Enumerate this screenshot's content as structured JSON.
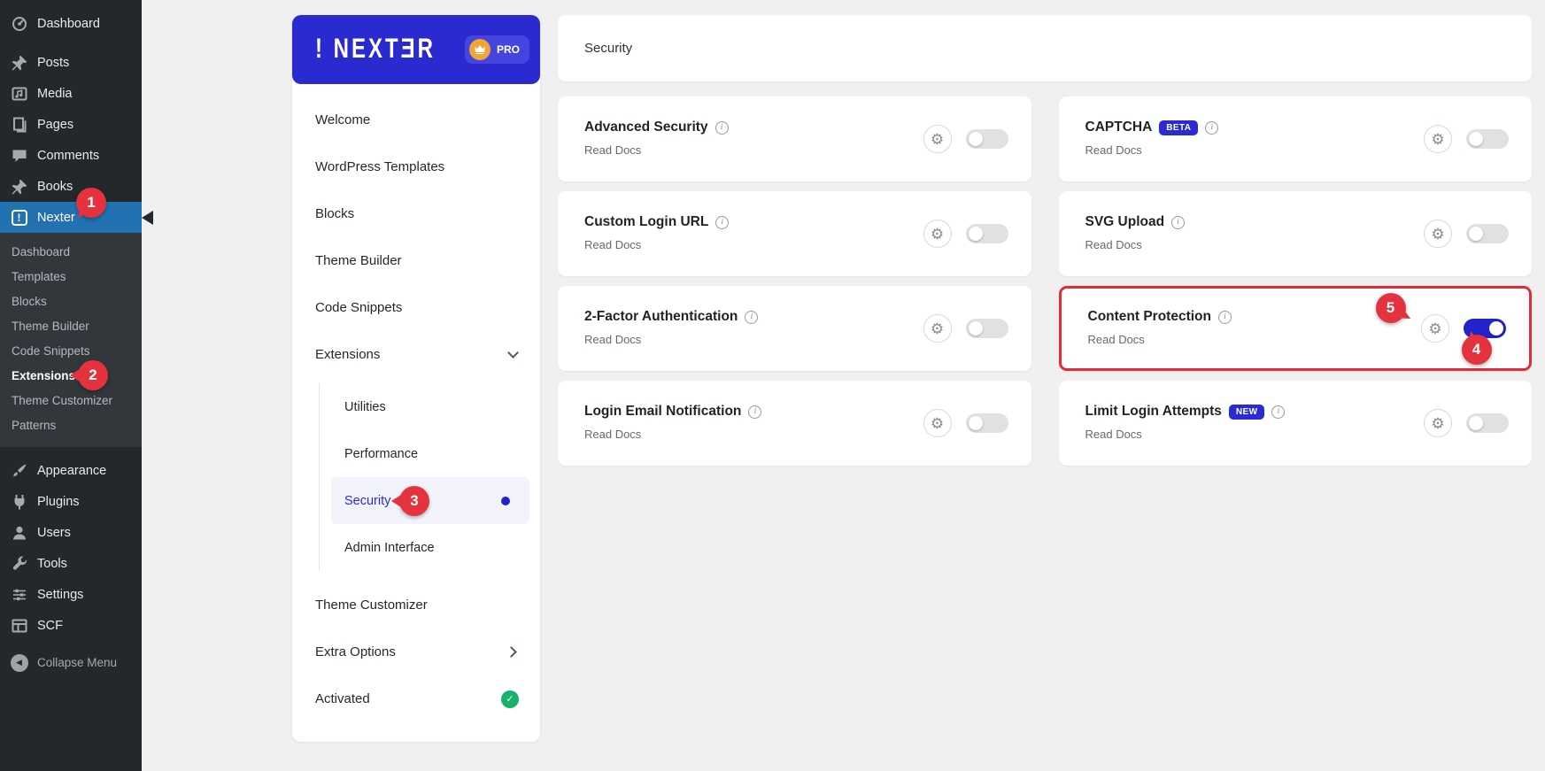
{
  "colors": {
    "brand_blue": "#2a2ad0",
    "toggle_on_blue": "#2323cd",
    "wp_active_blue": "#2271b1",
    "callout_red": "#e4323f",
    "highlight_border_red": "#e12d39",
    "success_green": "#17b26a",
    "badge_blue": "#2b2bd3"
  },
  "icons": {
    "gear": "⚙",
    "check": "✓",
    "info": "i",
    "exclamation": "!",
    "collapse_arrow": "◀"
  },
  "admin_sidebar": {
    "items": [
      {
        "label": "Dashboard",
        "icon": "dashboard-icon"
      },
      {
        "label": "Posts",
        "icon": "pushpin-icon"
      },
      {
        "label": "Media",
        "icon": "media-icon"
      },
      {
        "label": "Pages",
        "icon": "pages-icon"
      },
      {
        "label": "Comments",
        "icon": "comment-icon"
      },
      {
        "label": "Books",
        "icon": "pushpin-icon"
      },
      {
        "label": "Nexter",
        "icon": "nexter-icon",
        "active": true,
        "callout": "1"
      }
    ],
    "nexter_submenu": [
      "Dashboard",
      "Templates",
      "Blocks",
      "Theme Builder",
      "Code Snippets",
      "Extensions",
      "Theme Customizer",
      "Patterns"
    ],
    "extensions_callout": "2",
    "lower_items": [
      {
        "label": "Appearance",
        "icon": "brush-icon"
      },
      {
        "label": "Plugins",
        "icon": "plug-icon"
      },
      {
        "label": "Users",
        "icon": "user-icon"
      },
      {
        "label": "Tools",
        "icon": "wrench-icon"
      },
      {
        "label": "Settings",
        "icon": "sliders-icon"
      },
      {
        "label": "SCF",
        "icon": "table-icon"
      }
    ],
    "collapse_label": "Collapse Menu"
  },
  "panel": {
    "logo_text": "! NEXTƎR",
    "pro_label": "PRO",
    "menu": [
      "Welcome",
      "WordPress Templates",
      "Blocks",
      "Theme Builder",
      "Code Snippets"
    ],
    "extensions_label": "Extensions",
    "extensions_submenu": [
      "Utilities",
      "Performance",
      "Security",
      "Admin Interface"
    ],
    "security_callout": "3",
    "bottom_menu": [
      "Theme Customizer",
      "Extra Options",
      "Activated"
    ]
  },
  "main": {
    "page_title": "Security",
    "read_docs_label": "Read Docs",
    "cards": [
      {
        "title": "Advanced Security",
        "toggle_on": false
      },
      {
        "title": "CAPTCHA",
        "badge": "BETA",
        "toggle_on": false
      },
      {
        "title": "Custom Login URL",
        "toggle_on": false
      },
      {
        "title": "SVG Upload",
        "toggle_on": false
      },
      {
        "title": "2-Factor Authentication",
        "toggle_on": false
      },
      {
        "title": "Content Protection",
        "toggle_on": true,
        "highlighted": true,
        "gear_callout": "5",
        "toggle_callout": "4"
      },
      {
        "title": "Login Email Notification",
        "toggle_on": false
      },
      {
        "title": "Limit Login Attempts",
        "badge": "NEW",
        "toggle_on": false
      }
    ]
  }
}
